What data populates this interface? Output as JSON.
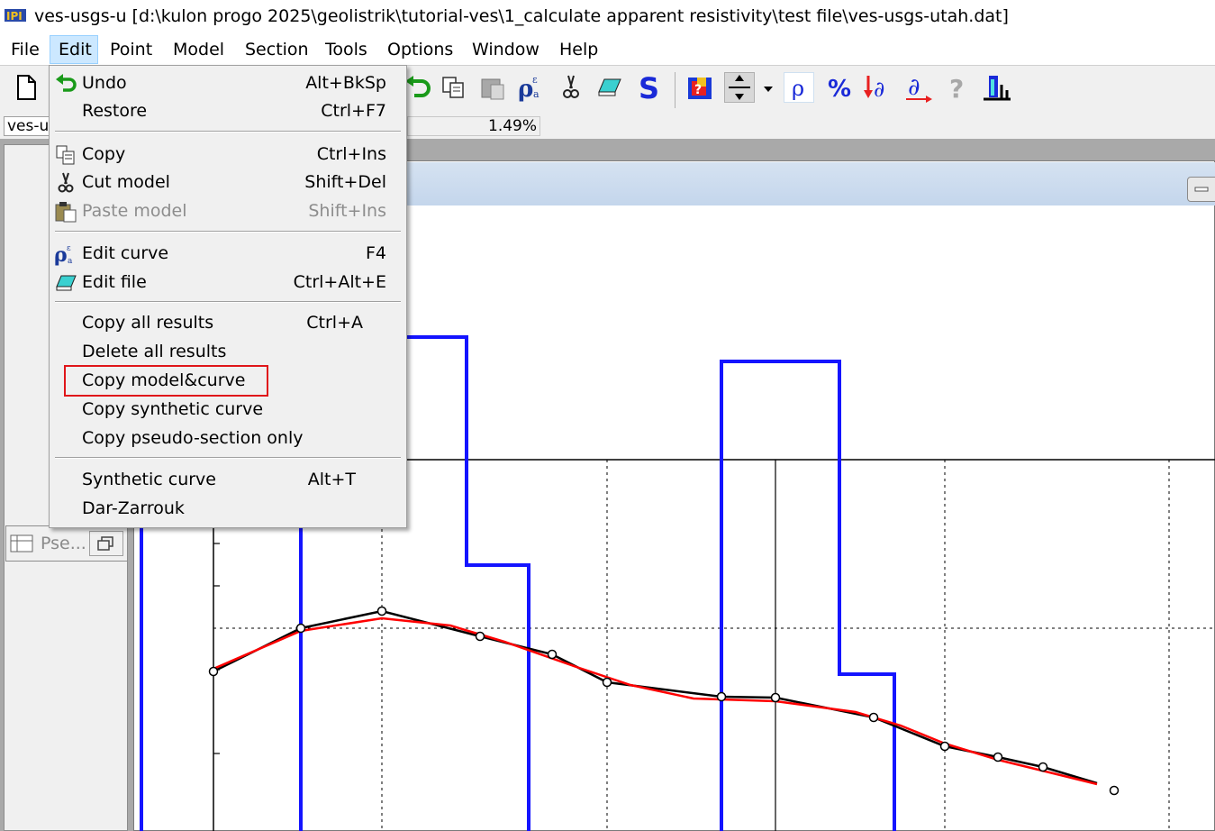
{
  "window": {
    "title": "ves-usgs-u [d:\\kulon progo 2025\\geolistrik\\tutorial-ves\\1_calculate apparent resistivity\\test file\\ves-usgs-utah.dat]"
  },
  "menubar": {
    "items": [
      "File",
      "Edit",
      "Point",
      "Model",
      "Section",
      "Tools",
      "Options",
      "Window",
      "Help"
    ]
  },
  "toolbar": {
    "icons": [
      "new-file-icon",
      "undo-icon",
      "copy-icon",
      "paste-icon",
      "edit-curve-icon",
      "cut-icon",
      "edit-file-icon",
      "synthetic-s-icon",
      "color-scale-icon",
      "split-icon",
      "rho-icon",
      "percent-icon",
      "down-derivative-icon",
      "derivative-icon",
      "help-icon",
      "ruler-icon"
    ]
  },
  "status": {
    "left_label": "ves-u",
    "percent": "1.49%"
  },
  "left_pane": {
    "tab_label": "Pse..."
  },
  "edit_menu": {
    "items": [
      {
        "label": "Undo",
        "shortcut": "Alt+BkSp",
        "icon": "undo-icon"
      },
      {
        "label": "Restore",
        "shortcut": "Ctrl+F7"
      },
      {
        "label": "Copy",
        "shortcut": "Ctrl+Ins",
        "icon": "copy-icon"
      },
      {
        "label": "Cut model",
        "shortcut": "Shift+Del",
        "icon": "scissors-icon"
      },
      {
        "label": "Paste model",
        "shortcut": "Shift+Ins",
        "icon": "paste-icon",
        "disabled": true
      },
      {
        "label": "Edit curve",
        "shortcut": "F4",
        "icon": "rho-curve-icon"
      },
      {
        "label": "Edit file",
        "shortcut": "Ctrl+Alt+E",
        "icon": "edit-file-icon"
      },
      {
        "label": "Copy all results",
        "shortcut": "Ctrl+A"
      },
      {
        "label": "Delete all results",
        "shortcut": ""
      },
      {
        "label": "Copy model&curve",
        "shortcut": "",
        "highlighted": true
      },
      {
        "label": "Copy synthetic curve",
        "shortcut": ""
      },
      {
        "label": "Copy pseudo-section only",
        "shortcut": ""
      },
      {
        "label": "Synthetic curve",
        "shortcut": "Alt+T"
      },
      {
        "label": "Dar-Zarrouk",
        "shortcut": ""
      }
    ]
  },
  "colors": {
    "model_line": "#1414ff",
    "synthetic_curve": "#ff0000",
    "field_curve": "#000000",
    "highlight_box": "#e0161a",
    "menu_hover": "#cce8ff"
  }
}
